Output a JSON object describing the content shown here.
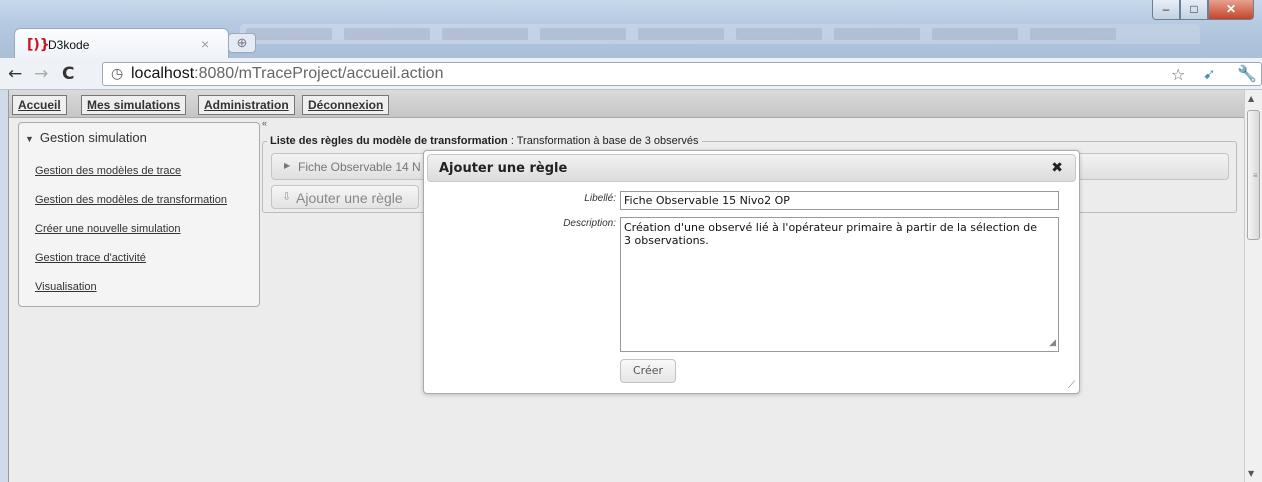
{
  "browser": {
    "tab_title": "D3kode",
    "tab_favicon": "D3-logo-icon",
    "url_host": "localhost",
    "url_path": ":8080/mTraceProject/accueil.action"
  },
  "menubar": {
    "items": [
      "Accueil",
      "Mes simulations",
      "Administration",
      "Déconnexion"
    ]
  },
  "sidebar": {
    "header": "Gestion simulation",
    "links": [
      "Gestion des modèles de trace",
      "Gestion des modèles de transformation",
      "Créer une nouvelle simulation",
      "Gestion trace d'activité",
      "Visualisation"
    ]
  },
  "rules": {
    "legend_bold": "Liste des règles du modèle de transformation",
    "legend_rest": " : Transformation à base de 3 observés",
    "row_label": "Fiche Observable 14 N",
    "add_button": "Ajouter une règle"
  },
  "dialog": {
    "title": "Ajouter une règle",
    "libelle_label": "Libellé:",
    "libelle_value": "Fiche Observable 15 Nivo2 OP",
    "description_label": "Description:",
    "description_value": "Création d'une observé lié à l'opérateur primaire à partir de la sélection de\n3 observations.",
    "create_button": "Créer"
  }
}
